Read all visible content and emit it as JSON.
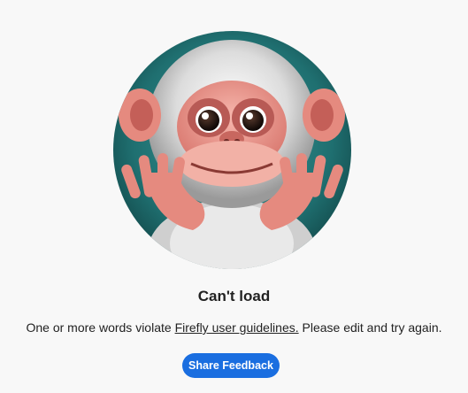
{
  "error": {
    "title": "Can't load",
    "message_before": "One or more words violate ",
    "link_text": "Firefly user guidelines.",
    "message_after": " Please edit and try again."
  },
  "actions": {
    "share_feedback_label": "Share Feedback",
    "button_color": "#1a6ee0"
  },
  "illustration": {
    "subject": "monkey-illustration",
    "background_color": "#1f6f70"
  }
}
